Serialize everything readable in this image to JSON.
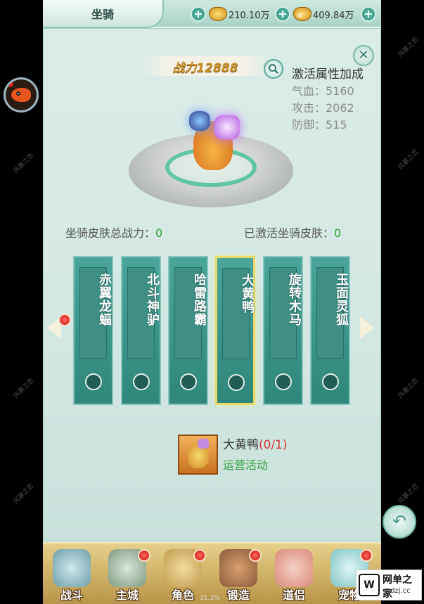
{
  "watermark": "风暴之恋",
  "header": {
    "tab_title": "坐骑",
    "gold_amount": "210.10万",
    "bound_gold_amount": "409.84万",
    "bound_badge": "绑"
  },
  "mount_panel": {
    "combat_power": "战力12888",
    "attributes": {
      "title": "激活属性加成",
      "hp": "气血：5160",
      "attack": "攻击：2062",
      "defense": "防御：515"
    },
    "skin_total_power_label": "坐骑皮肤总战力：",
    "skin_total_power_value": "0",
    "activated_skins_label": "已激活坐骑皮肤：",
    "activated_skins_value": "0"
  },
  "skins": [
    {
      "name": "赤翼龙蝠",
      "selected": false
    },
    {
      "name": "北斗神驴",
      "selected": false
    },
    {
      "name": "哈雷路霸",
      "selected": false
    },
    {
      "name": "大黄鸭",
      "selected": true
    },
    {
      "name": "旋转木马",
      "selected": false
    },
    {
      "name": "玉面灵狐",
      "selected": false
    }
  ],
  "selected_item": {
    "name": "大黄鸭",
    "progress": "(0/1)",
    "source": "运营活动"
  },
  "bottom_nav": [
    {
      "label": "战斗",
      "badge": false,
      "color": "#6aa0a8"
    },
    {
      "label": "主城",
      "badge": true,
      "color": "#7d9a82"
    },
    {
      "label": "角色",
      "badge": true,
      "color": "#c29a4e"
    },
    {
      "label": "锻造",
      "badge": true,
      "color": "#8a5a3c"
    },
    {
      "label": "道侣",
      "badge": false,
      "color": "#d9897a"
    },
    {
      "label": "宠物",
      "badge": true,
      "color": "#7fc4c4"
    }
  ],
  "loading_percent": "31.3%",
  "site_logo": {
    "mark": "W",
    "cn": "网单之家",
    "en": "wdzj.cc"
  },
  "colors": {
    "accent_teal": "#2f8679",
    "power_gold": "#c8922a",
    "positive_green": "#2f9f3a",
    "alert_red": "#d8343a"
  }
}
